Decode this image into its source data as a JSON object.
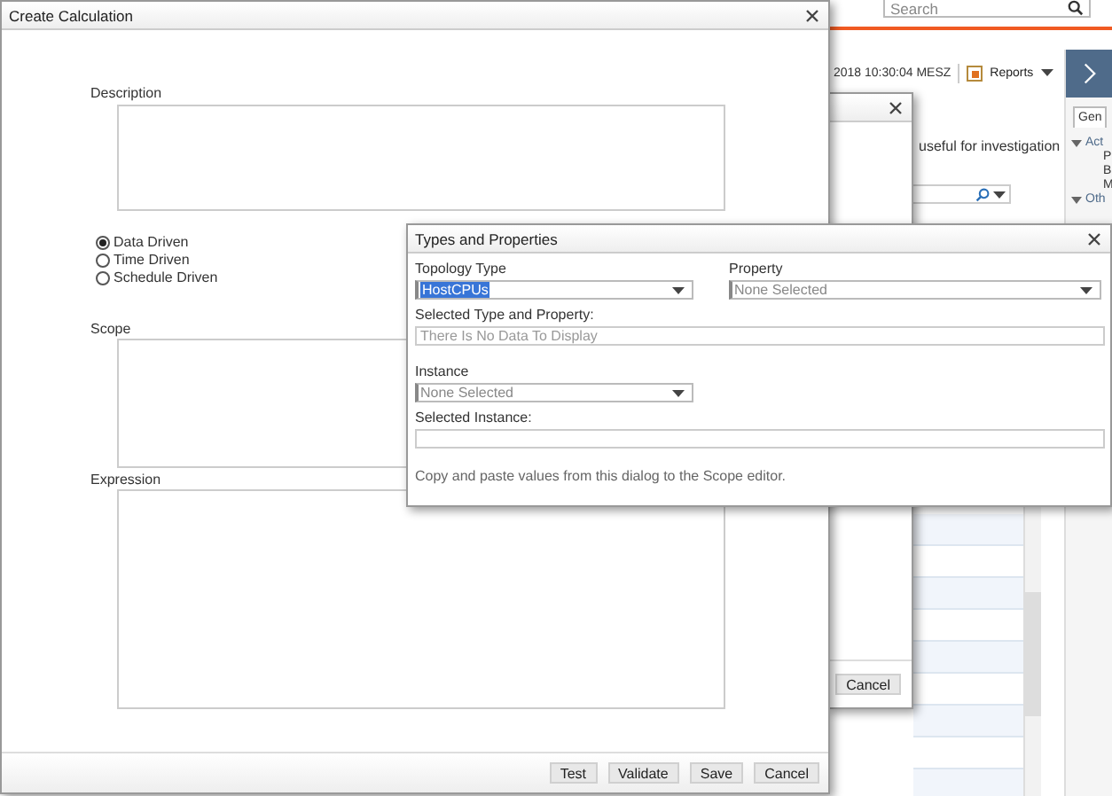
{
  "background_app": {
    "search": {
      "placeholder": "Search"
    },
    "timestamp": "2018 10:30:04 MESZ",
    "reports_button": "Reports",
    "info_text": "useful for investigation",
    "side_panel": {
      "tab": "Gen",
      "tree": [
        {
          "label": "Act",
          "expanded": true,
          "children": [
            {
              "label": "P"
            },
            {
              "label": "B"
            },
            {
              "label": "M"
            }
          ]
        },
        {
          "label": "Oth",
          "expanded": true
        }
      ]
    }
  },
  "background_dialog": {
    "buttons": [
      "Cancel"
    ]
  },
  "create_calculation": {
    "title": "Create Calculation",
    "description_label": "Description",
    "trigger_options": [
      {
        "label": "Data Driven",
        "selected": true
      },
      {
        "label": "Time Driven",
        "selected": false
      },
      {
        "label": "Schedule Driven",
        "selected": false
      }
    ],
    "scope_label": "Scope",
    "expression_label": "Expression",
    "buttons": [
      "Test",
      "Validate",
      "Save",
      "Cancel"
    ]
  },
  "types_and_properties": {
    "title": "Types and Properties",
    "topology_type": {
      "label": "Topology Type",
      "value": "HostCPUs",
      "highlighted": true
    },
    "property": {
      "label": "Property",
      "value": "None Selected",
      "highlighted": false
    },
    "selected_type_and_property": {
      "label": "Selected Type and Property:",
      "placeholder": "There Is No Data To Display"
    },
    "instance": {
      "label": "Instance",
      "value": "None Selected",
      "highlighted": false
    },
    "selected_instance": {
      "label": "Selected Instance:"
    },
    "note": "Copy and paste values from this dialog to the Scope editor."
  }
}
